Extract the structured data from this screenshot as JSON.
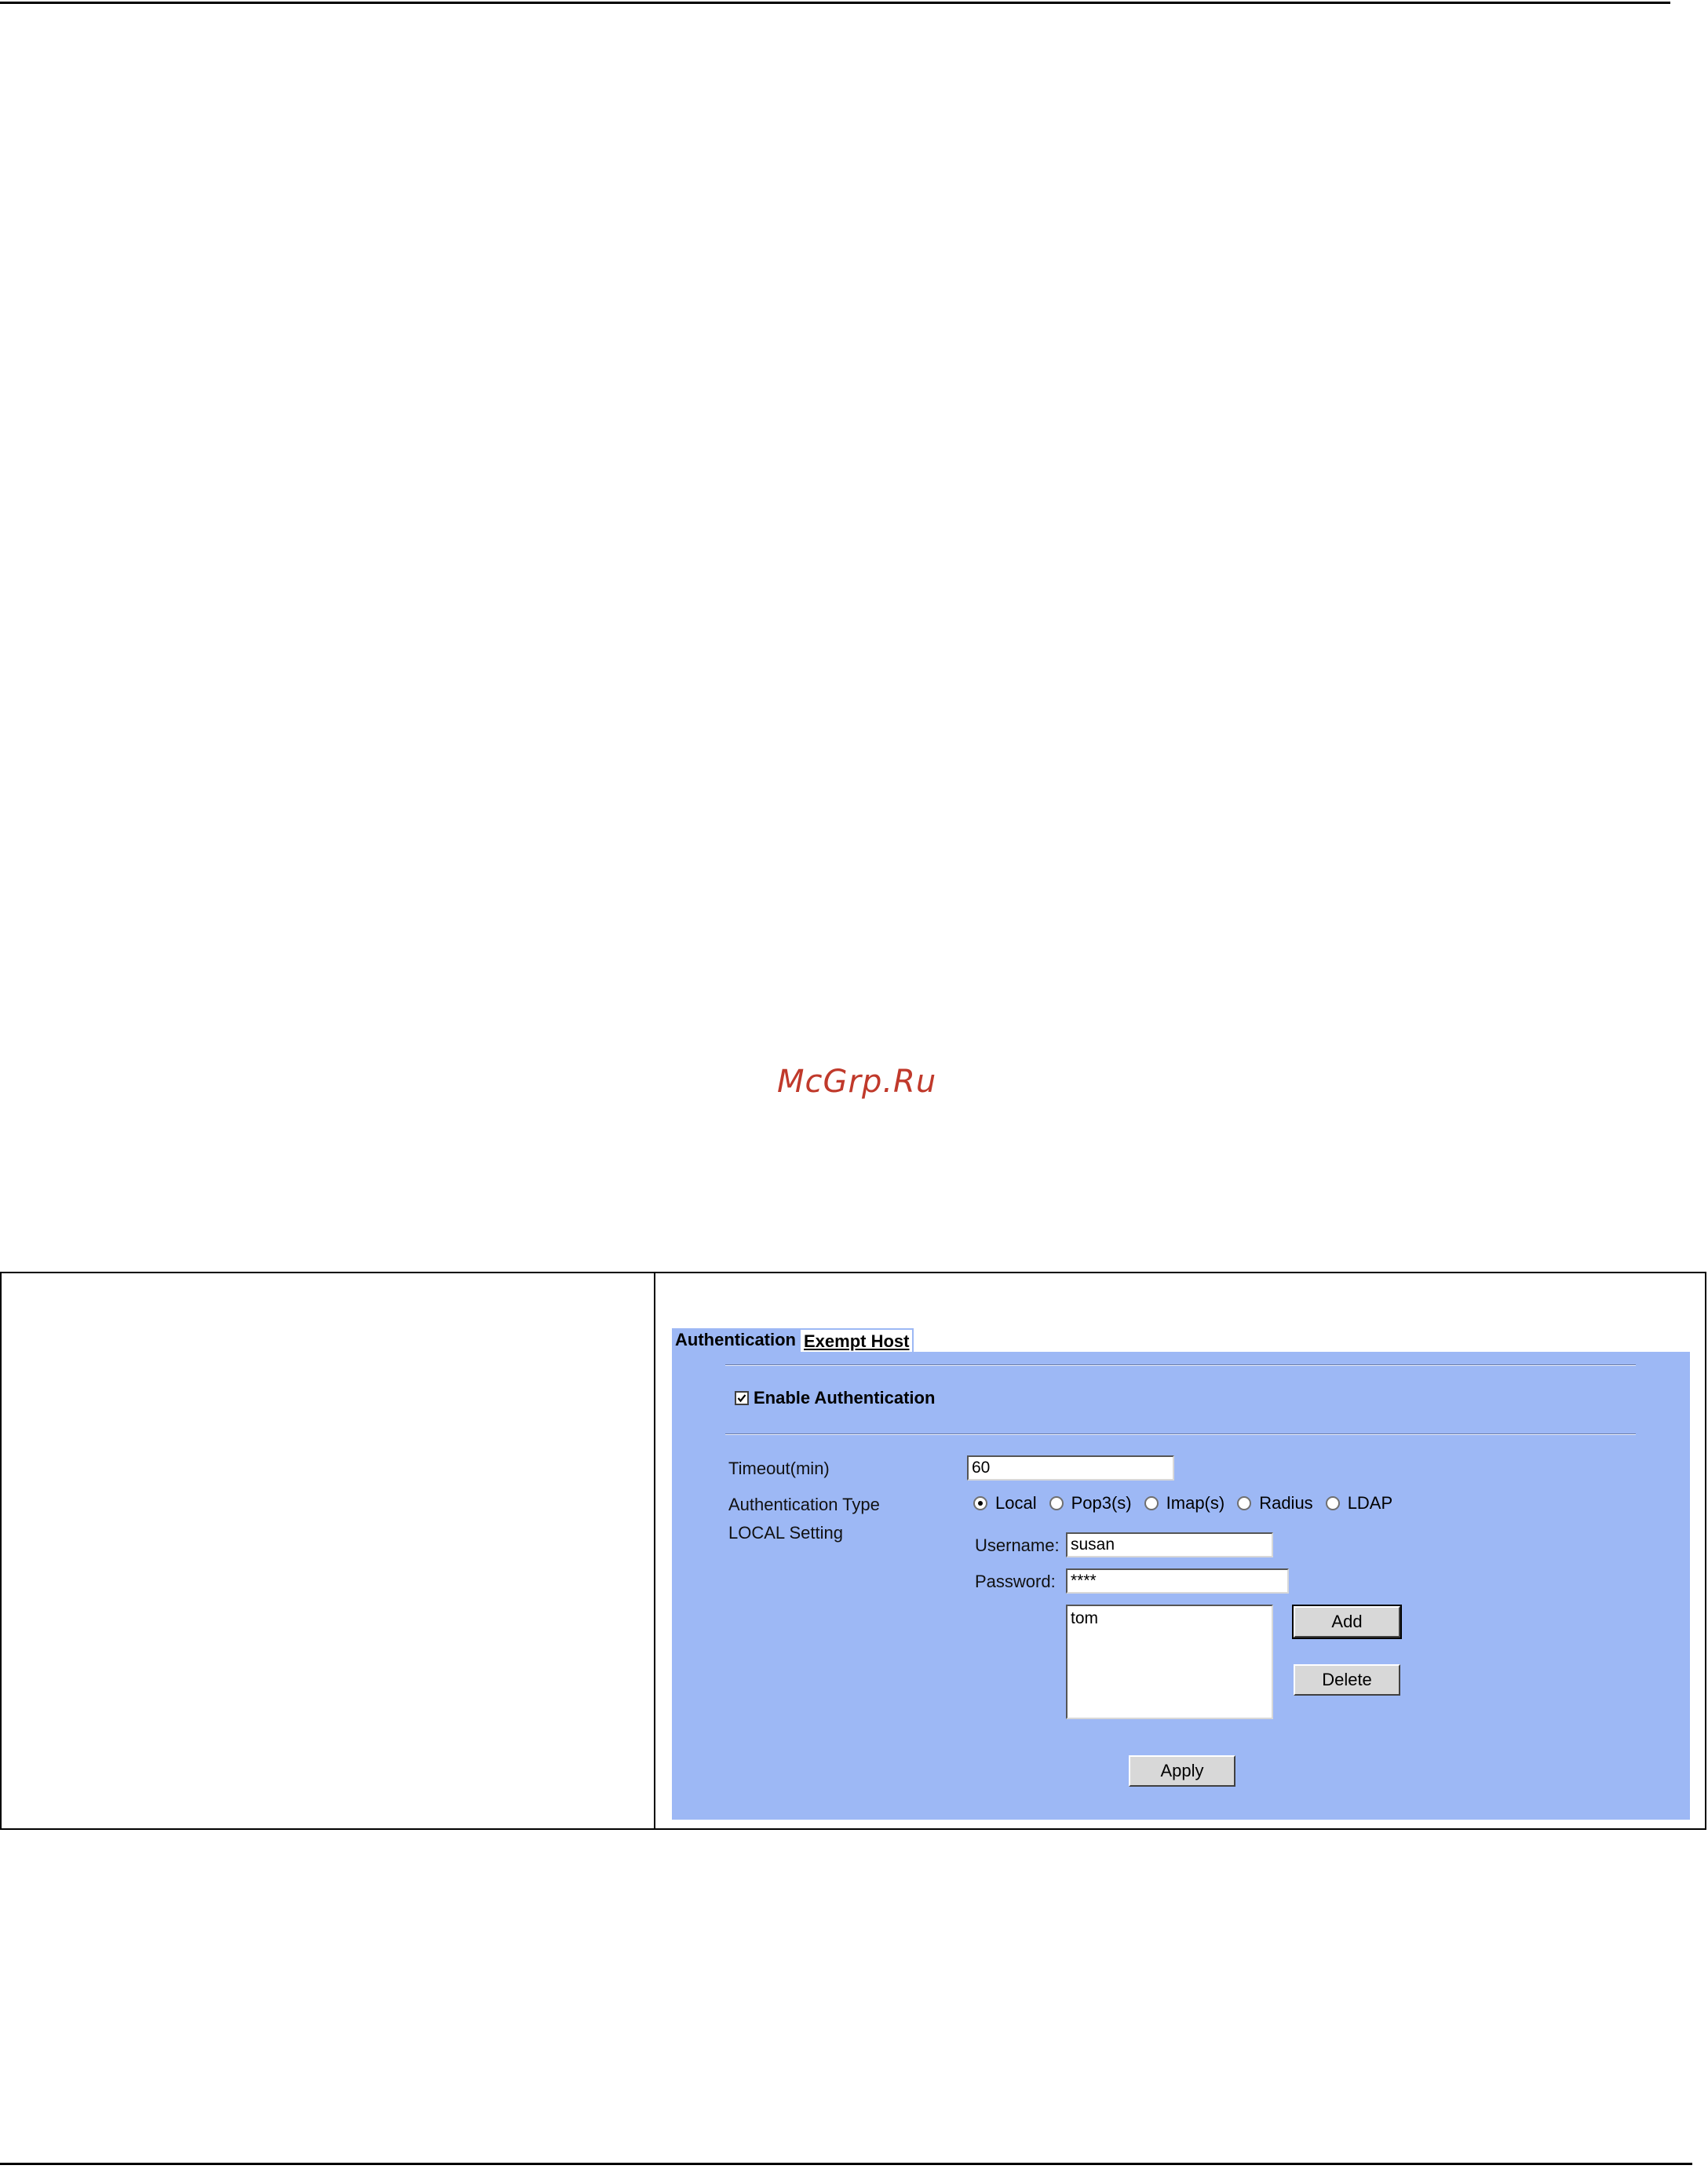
{
  "watermark": "McGrp.Ru",
  "tabs": [
    {
      "label": "Authentication",
      "active": true
    },
    {
      "label": "Exempt Host",
      "active": false
    }
  ],
  "form": {
    "enable_label": "Enable Authentication",
    "enable_checked": true,
    "timeout_label": "Timeout(min)",
    "timeout_value": "60",
    "auth_type_label": "Authentication Type",
    "auth_types": [
      {
        "label": "Local",
        "selected": true
      },
      {
        "label": "Pop3(s)",
        "selected": false
      },
      {
        "label": "Imap(s)",
        "selected": false
      },
      {
        "label": "Radius",
        "selected": false
      },
      {
        "label": "LDAP",
        "selected": false
      }
    ],
    "local_setting_label": "LOCAL Setting",
    "username_label": "Username:",
    "username_value": "susan",
    "password_label": "Password:",
    "password_value": "****",
    "user_list": [
      "tom"
    ],
    "add_button": "Add",
    "delete_button": "Delete",
    "apply_button": "Apply"
  },
  "colors": {
    "panel_bg": "#9db8f5",
    "watermark": "#c0392b"
  }
}
